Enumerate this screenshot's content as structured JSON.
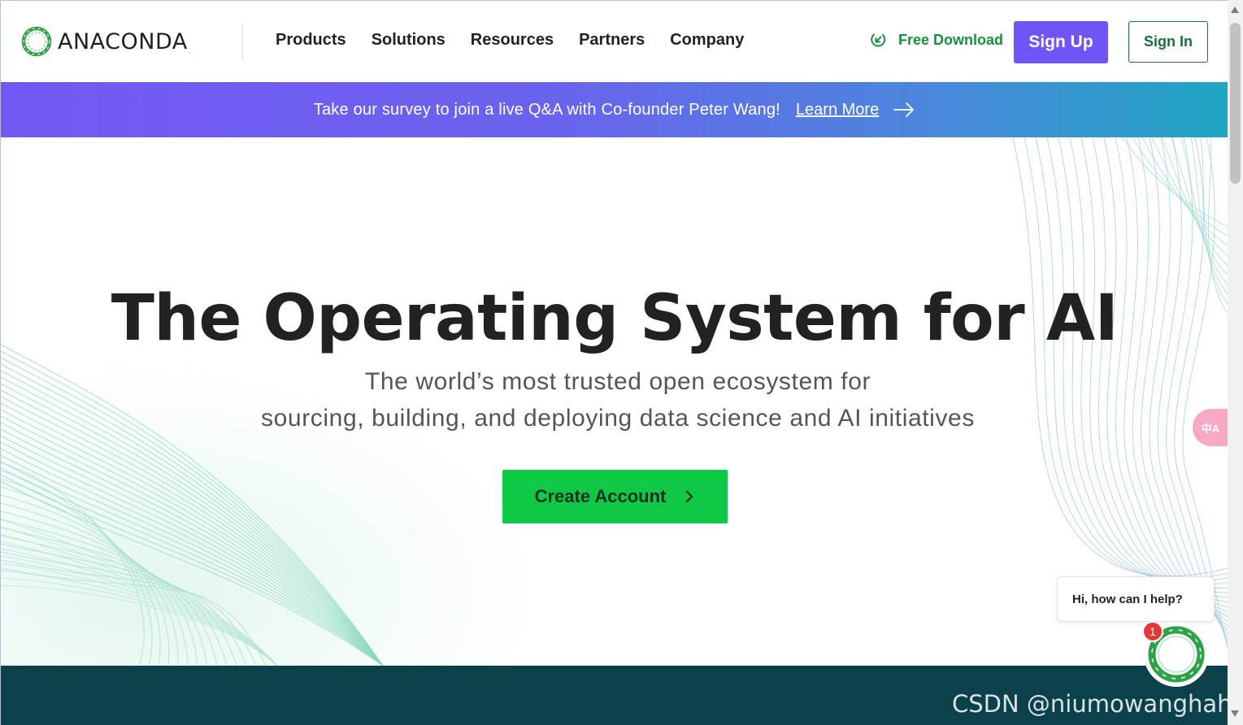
{
  "brand": {
    "name": "ANACONDA",
    "reg_mark": ".",
    "logo_icon": "anaconda-ring-icon",
    "color_green": "#17913e"
  },
  "nav": {
    "items": [
      "Products",
      "Solutions",
      "Resources",
      "Partners",
      "Company"
    ]
  },
  "header": {
    "free_download": "Free Download",
    "sign_up": "Sign Up",
    "sign_in": "Sign In",
    "accent_purple": "#7054f4"
  },
  "banner": {
    "text": "Take our survey to join a live Q&A with Co-founder Peter Wang!",
    "link": "Learn More"
  },
  "hero": {
    "title": "The Operating System for AI",
    "subtitle_line1": "The world’s most trusted open ecosystem for",
    "subtitle_line2": "sourcing, building, and deploying data science and AI initiatives",
    "cta": "Create Account",
    "cta_color": "#0fc845"
  },
  "chat": {
    "prompt": "Hi, how can I help?",
    "badge_count": "1"
  },
  "translate": {
    "label": "中A"
  },
  "watermark": "CSDN @niumowanghahaha"
}
